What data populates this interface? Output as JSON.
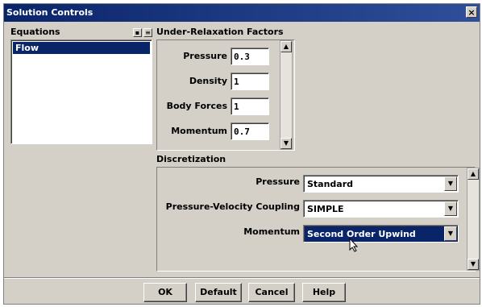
{
  "window": {
    "title": "Solution Controls",
    "close_glyph": "×"
  },
  "equations": {
    "heading": "Equations",
    "items": [
      {
        "label": "Flow",
        "selected": true
      }
    ]
  },
  "relaxation": {
    "heading": "Under-Relaxation Factors",
    "fields": [
      {
        "label": "Pressure",
        "value": "0.3"
      },
      {
        "label": "Density",
        "value": "1"
      },
      {
        "label": "Body Forces",
        "value": "1"
      },
      {
        "label": "Momentum",
        "value": "0.7"
      }
    ]
  },
  "discretization": {
    "heading": "Discretization",
    "rows": [
      {
        "label": "Pressure",
        "value": "Standard"
      },
      {
        "label": "Pressure-Velocity Coupling",
        "value": "SIMPLE"
      },
      {
        "label": "Momentum",
        "value": "Second Order Upwind"
      }
    ]
  },
  "buttons": {
    "ok": "OK",
    "default": "Default",
    "cancel": "Cancel",
    "help": "Help"
  },
  "colors": {
    "title_bar": "#0a246a",
    "selection": "#0a246a",
    "dialog_bg": "#d4d0c8"
  }
}
